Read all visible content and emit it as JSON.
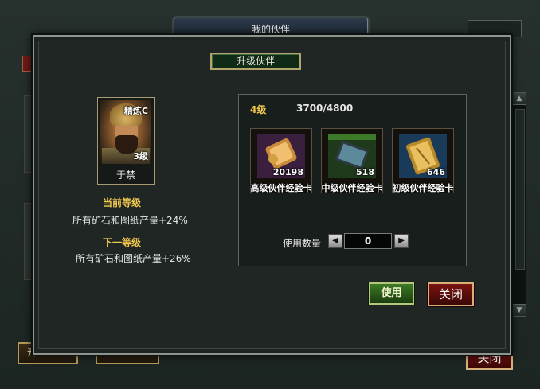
{
  "background": {
    "title": "我的伙伴",
    "button_left_1": "升级伙伴",
    "button_left_2": "",
    "close_label": "关闭"
  },
  "dialog": {
    "title": "升级伙伴",
    "partner": {
      "name": "于禁",
      "rank_badge": "精炼C",
      "level_badge": "3级"
    },
    "current_level_label": "当前等级",
    "current_effect": "所有矿石和图纸产量+24%",
    "next_level_label": "下一等级",
    "next_effect": "所有矿石和图纸产量+26%",
    "exp_panel": {
      "level": "4级",
      "exp": "3700/4800",
      "items": [
        {
          "name": "高级伙伴经验卡",
          "count": "20198",
          "icon": "scroll-purple-icon"
        },
        {
          "name": "中级伙伴经验卡",
          "count": "518",
          "icon": "book-green-icon"
        },
        {
          "name": "初级伙伴经验卡",
          "count": "646",
          "icon": "scroll-gold-icon"
        }
      ],
      "quantity_label": "使用数量",
      "quantity_value": "0"
    },
    "use_button": "使用",
    "close_button": "关闭"
  },
  "colors": {
    "gold": "#f2c94c",
    "use_green": "#3c7a26",
    "close_red": "#7a1410"
  }
}
